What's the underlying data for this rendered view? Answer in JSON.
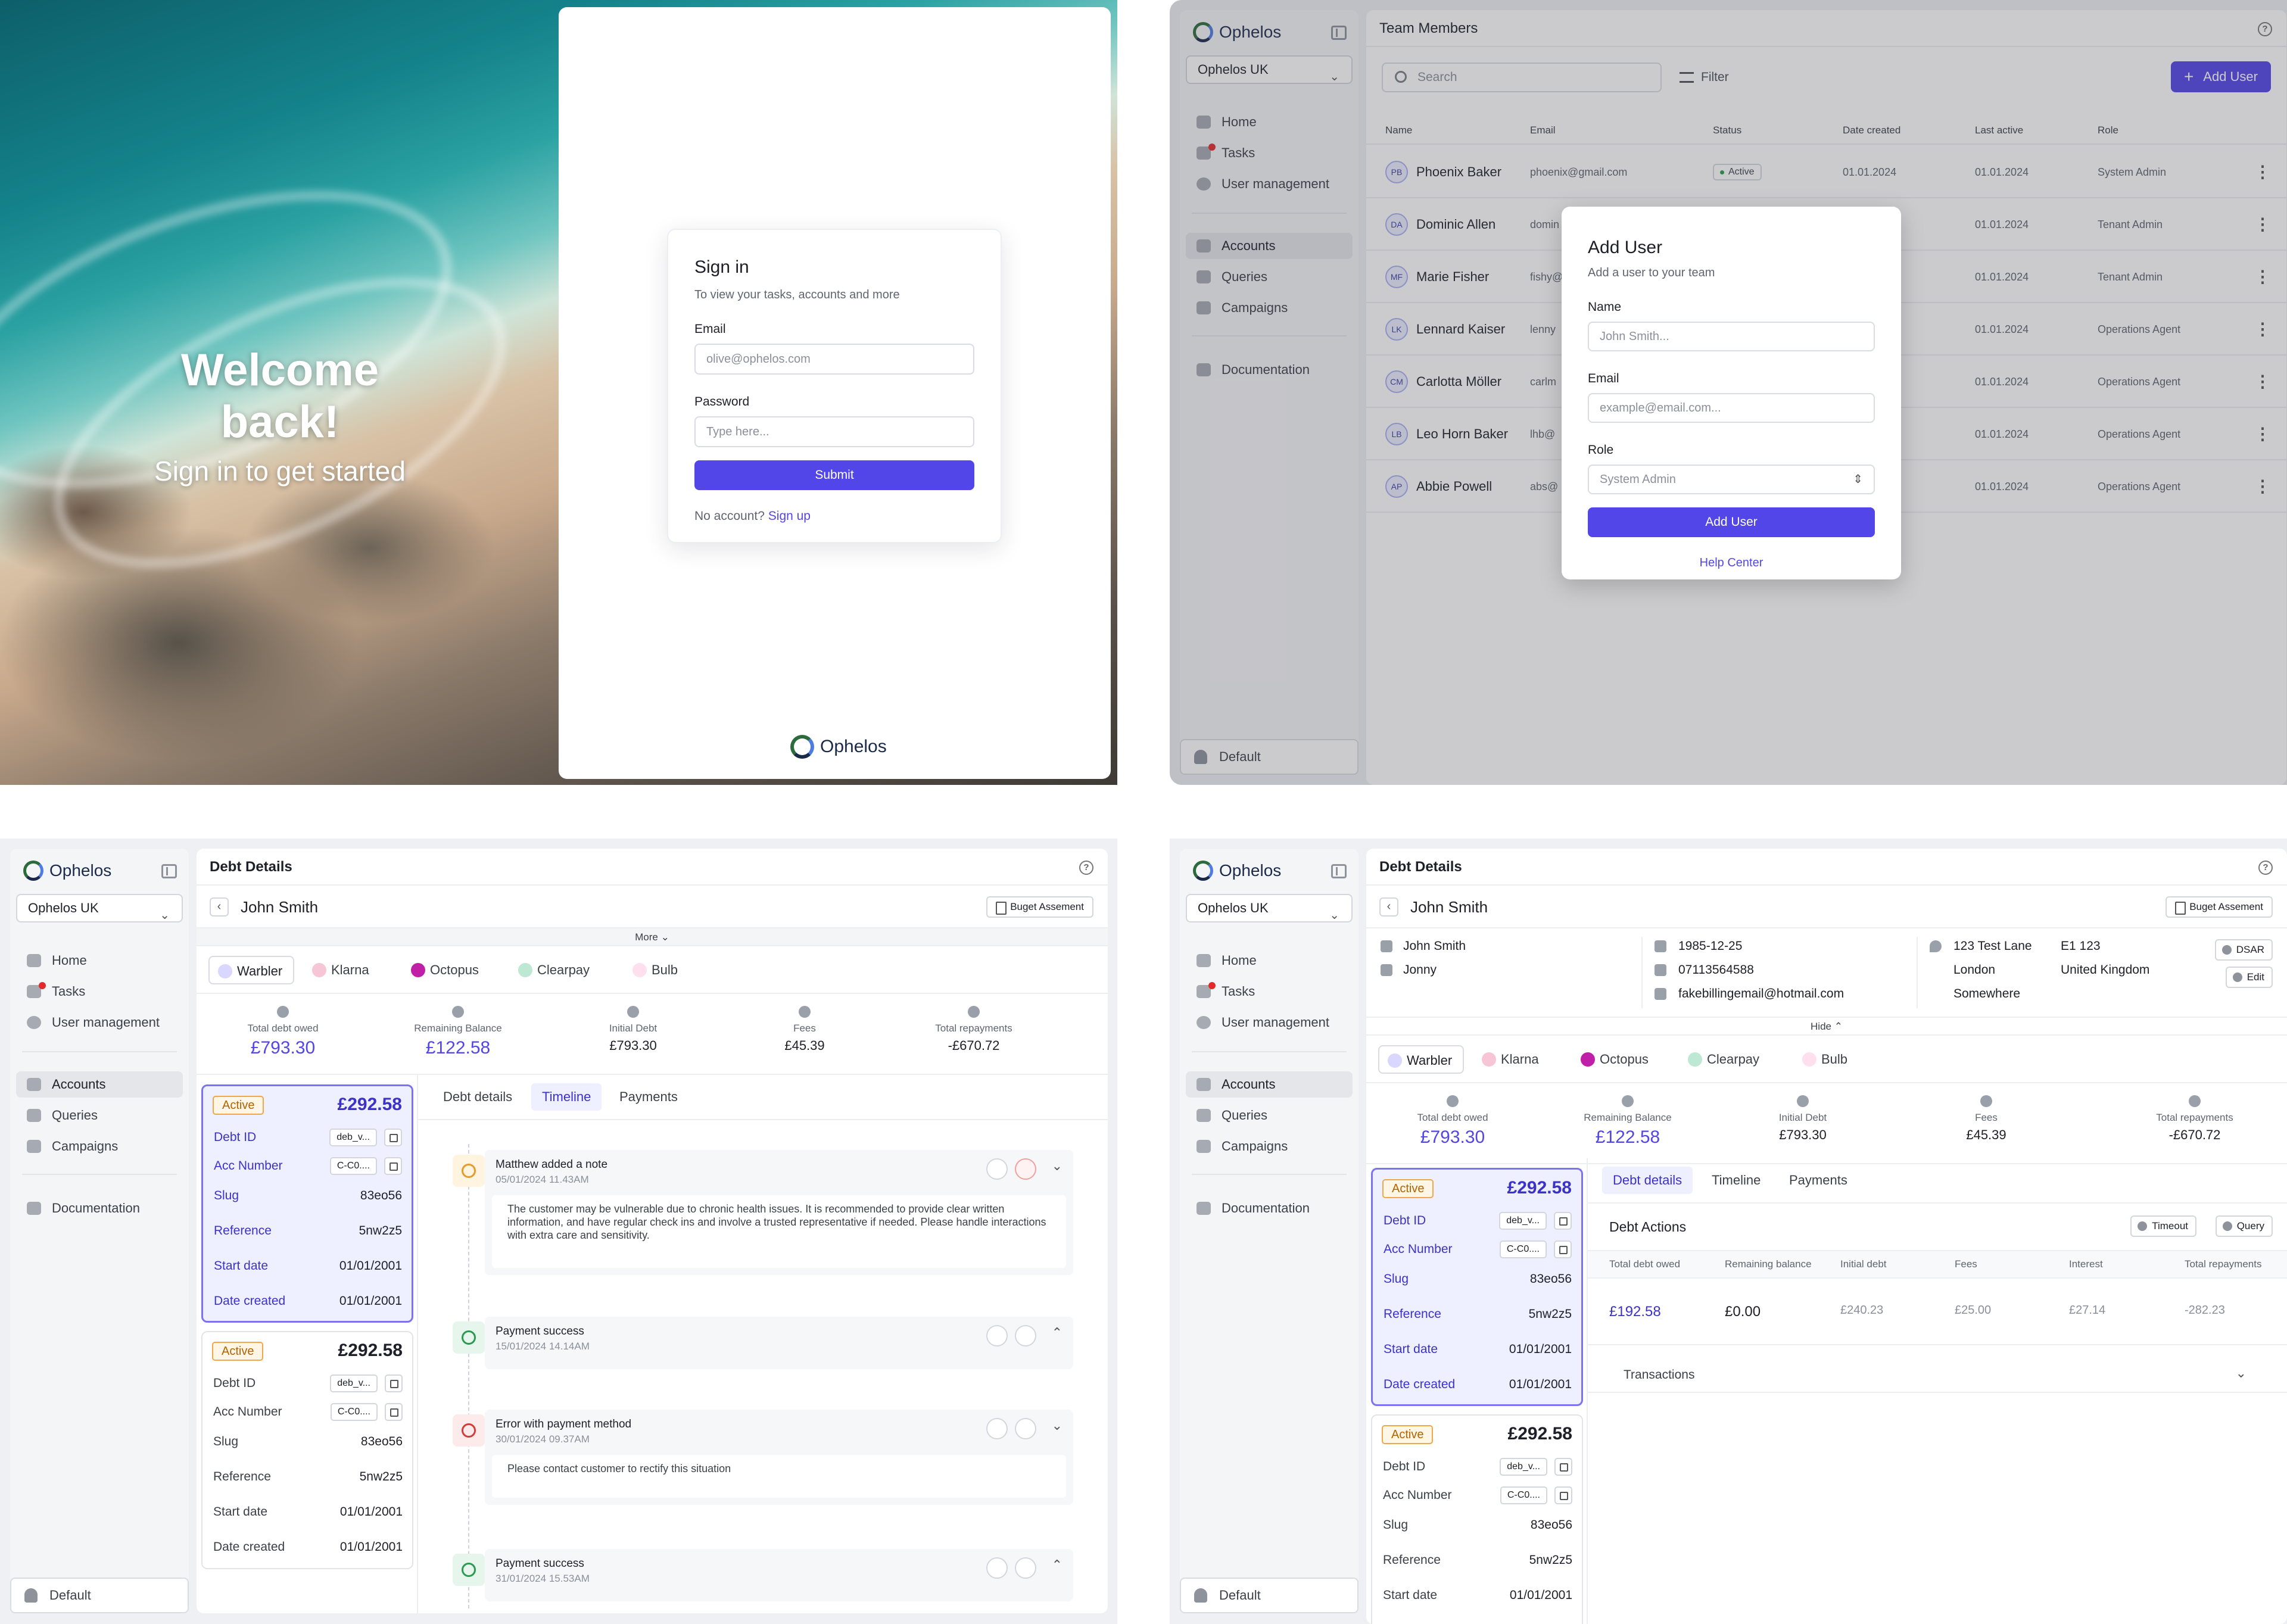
{
  "brand": {
    "name": "Ophelos",
    "accent": "#5246e8"
  },
  "signin": {
    "welcome": "Welcome back!",
    "tagline": "Sign in to get started",
    "title": "Sign in",
    "subtitle": "To view your tasks, accounts and more",
    "email_label": "Email",
    "email_placeholder": "olive@ophelos.com",
    "password_label": "Password",
    "password_placeholder": "Type here...",
    "submit": "Submit",
    "no_account": "No account?",
    "signup": "Sign up"
  },
  "sidebar": {
    "org": "Ophelos UK",
    "items": [
      {
        "label": "Home",
        "icon": "home-icon"
      },
      {
        "label": "Tasks",
        "icon": "tasks-icon"
      },
      {
        "label": "User management",
        "icon": "user-icon"
      },
      {
        "label": "Accounts",
        "icon": "accounts-icon"
      },
      {
        "label": "Queries",
        "icon": "queries-icon"
      },
      {
        "label": "Campaigns",
        "icon": "megaphone-icon"
      },
      {
        "label": "Documentation",
        "icon": "book-icon"
      }
    ],
    "footer": "Default"
  },
  "team": {
    "title": "Team Members",
    "search_placeholder": "Search",
    "filter": "Filter",
    "add_user": "Add User",
    "columns": [
      "Name",
      "Email",
      "Status",
      "Date created",
      "Last active",
      "Role"
    ],
    "rows": [
      {
        "initials": "PB",
        "name": "Phoenix Baker",
        "email": "phoenix@gmail.com",
        "status": "Active",
        "created": "01.01.2024",
        "last": "01.01.2024",
        "role": "System Admin"
      },
      {
        "initials": "DA",
        "name": "Dominic Allen",
        "email": "domin",
        "status": "",
        "created": "",
        "last": "01.01.2024",
        "role": "Tenant Admin"
      },
      {
        "initials": "MF",
        "name": "Marie Fisher",
        "email": "fishy@",
        "status": "",
        "created": "",
        "last": "01.01.2024",
        "role": "Tenant Admin"
      },
      {
        "initials": "LK",
        "name": "Lennard Kaiser",
        "email": "lenny",
        "status": "",
        "created": "",
        "last": "01.01.2024",
        "role": "Operations Agent"
      },
      {
        "initials": "CM",
        "name": "Carlotta Möller",
        "email": "carlm",
        "status": "",
        "created": "",
        "last": "01.01.2024",
        "role": "Operations Agent"
      },
      {
        "initials": "LB",
        "name": "Leo Horn Baker",
        "email": "lhb@",
        "status": "",
        "created": "",
        "last": "01.01.2024",
        "role": "Operations Agent"
      },
      {
        "initials": "AP",
        "name": "Abbie Powell",
        "email": "abs@",
        "status": "",
        "created": "",
        "last": "01.01.2024",
        "role": "Operations Agent"
      }
    ]
  },
  "modal": {
    "title": "Add User",
    "subtitle": "Add a user to your team",
    "name_label": "Name",
    "name_placeholder": "John Smith...",
    "email_label": "Email",
    "email_placeholder": "example@email.com...",
    "role_label": "Role",
    "role_value": "System Admin",
    "submit": "Add User",
    "help": "Help Center"
  },
  "debt": {
    "title": "Debt Details",
    "person": "John Smith",
    "budget": "Buget Assement",
    "more": "More",
    "hide": "Hide",
    "creditors": [
      "Warbler",
      "Klarna",
      "Octopus",
      "Clearpay",
      "Bulb"
    ],
    "stats": [
      {
        "label": "Total debt owed",
        "value": "£793.30"
      },
      {
        "label": "Remaining Balance",
        "value": "£122.58"
      },
      {
        "label": "Initial Debt",
        "value": "£793.30"
      },
      {
        "label": "Fees",
        "value": "£45.39"
      },
      {
        "label": "Total repayments",
        "value": "-£670.72"
      }
    ],
    "card_labels": [
      "Debt ID",
      "Acc Number",
      "Slug",
      "Reference",
      "Start date",
      "Date created"
    ],
    "cards": [
      {
        "status": "Active",
        "amount": "£292.58",
        "debt_id": "deb_v...",
        "acc": "C-C0....",
        "slug": "83eo56",
        "ref": "5nw2z5",
        "start": "01/01/2001",
        "created": "01/01/2001"
      },
      {
        "status": "Active",
        "amount": "£292.58",
        "debt_id": "deb_v...",
        "acc": "C-C0....",
        "slug": "83eo56",
        "ref": "5nw2z5",
        "start": "01/01/2001",
        "created": "01/01/2001"
      }
    ],
    "tabs": [
      "Debt details",
      "Timeline",
      "Payments"
    ],
    "timeline": [
      {
        "title": "Matthew added a note",
        "date": "05/01/2024",
        "time": "11.43AM",
        "body": "The customer may be vulnerable due to chronic health issues. It is recommended to provide clear written information, and have regular check ins and involve a trusted representative if needed. Please handle interactions with extra care and sensitivity."
      },
      {
        "title": "Payment success",
        "date": "15/01/2024",
        "time": "14.14AM",
        "body": ""
      },
      {
        "title": "Error with payment method",
        "date": "30/01/2024",
        "time": "09.37AM",
        "body": "Please contact customer to rectify this situation"
      },
      {
        "title": "Payment success",
        "date": "31/01/2024",
        "time": "15.53AM",
        "body": ""
      }
    ],
    "info": {
      "name": "John Smith",
      "alias": "Jonny",
      "dob": "1985-12-25",
      "phone": "07113564588",
      "email": "fakebillingemail@hotmail.com",
      "address1": "123 Test Lane",
      "address2": "London",
      "address3": "Somewhere",
      "postcode": "E1 123",
      "country": "United Kingdom",
      "dsar": "DSAR",
      "edit": "Edit"
    },
    "actions": {
      "title": "Debt Actions",
      "timeout": "Timeout",
      "query": "Query",
      "columns": [
        "Total debt owed",
        "Remaining balance",
        "Initial debt",
        "Fees",
        "Interest",
        "Total repayments"
      ],
      "values": [
        "£192.58",
        "£0.00",
        "£240.23",
        "£25.00",
        "£27.14",
        "-282.23"
      ],
      "transactions": "Transactions"
    }
  }
}
